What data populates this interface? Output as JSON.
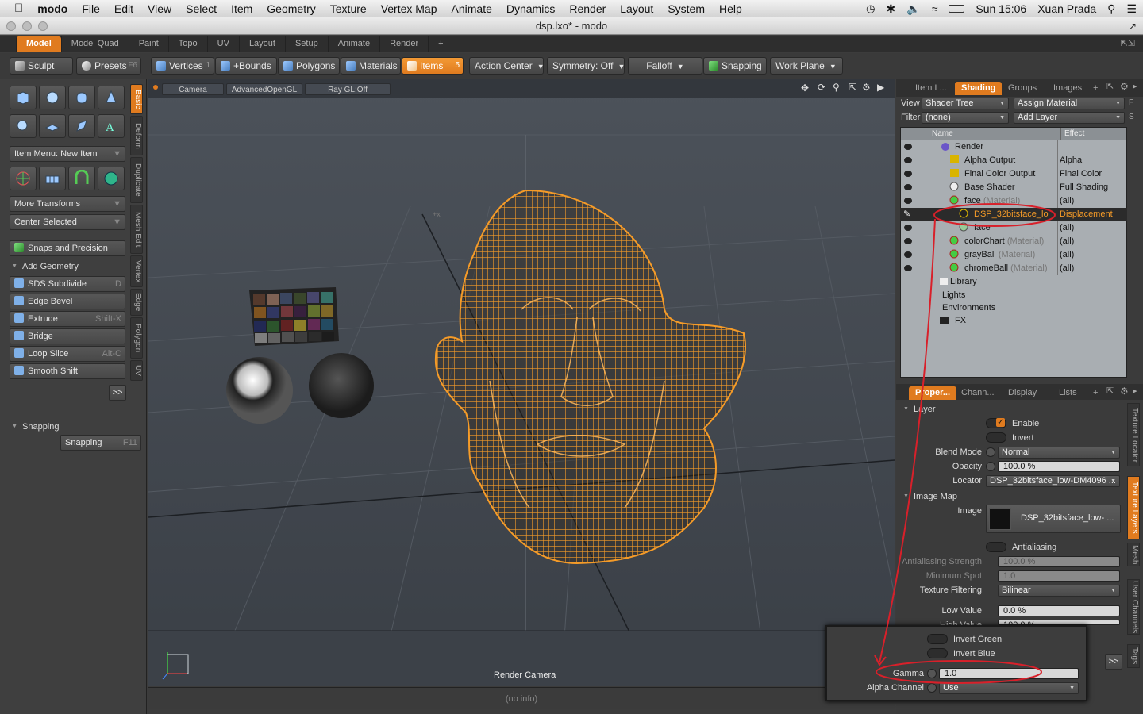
{
  "menubar": {
    "app": "modo",
    "items": [
      "File",
      "Edit",
      "View",
      "Select",
      "Item",
      "Geometry",
      "Texture",
      "Vertex Map",
      "Animate",
      "Dynamics",
      "Render",
      "Layout",
      "System",
      "Help"
    ],
    "clock": "Sun 15:06",
    "user": "Xuan Prada"
  },
  "window": {
    "title": "dsp.lxo* - modo"
  },
  "layout_tabs": [
    "Model",
    "Model Quad",
    "Paint",
    "Topo",
    "UV",
    "Layout",
    "Setup",
    "Animate",
    "Render",
    "+"
  ],
  "toolbar": {
    "sculpt": "Sculpt",
    "presets": "Presets",
    "presets_key": "F6",
    "vertices": "Vertices",
    "vertices_count": "1",
    "bounds": "+Bounds",
    "polygons": "Polygons",
    "materials": "Materials",
    "items": "Items",
    "items_count": "5",
    "action_center": "Action Center",
    "symmetry": "Symmetry: Off",
    "falloff": "Falloff",
    "snapping": "Snapping",
    "work_plane": "Work Plane"
  },
  "left": {
    "item_menu": "Item Menu: New Item",
    "more_transforms": "More Transforms",
    "center_selected": "Center Selected",
    "snaps": "Snaps and Precision",
    "add_geometry": "Add Geometry",
    "tools": [
      {
        "label": "SDS Subdivide",
        "key": "D"
      },
      {
        "label": "Edge Bevel",
        "key": ""
      },
      {
        "label": "Extrude",
        "key": "Shift-X"
      },
      {
        "label": "Bridge",
        "key": ""
      },
      {
        "label": "Loop Slice",
        "key": "Alt-C"
      },
      {
        "label": "Smooth Shift",
        "key": ""
      }
    ],
    "more_button": ">>",
    "snapping_header": "Snapping",
    "snapping_btn": "Snapping",
    "snapping_key": "F11",
    "vtabs": [
      "Basic",
      "Deform",
      "Duplicate",
      "Mesh Edit",
      "Vertex",
      "Edge",
      "Polygon",
      "UV"
    ]
  },
  "viewport": {
    "tabs": [
      "Camera",
      "AdvancedOpenGL",
      "Ray GL:Off"
    ],
    "camera_label": "Render Camera",
    "info": "(no info)",
    "colors": {
      "wire": "#f59b28",
      "bg": "#444a52"
    }
  },
  "shader": {
    "tabs": [
      "Item L...",
      "Shading",
      "Groups",
      "Images",
      "+"
    ],
    "view_label": "View",
    "view_value": "Shader Tree",
    "assign_material": "Assign Material",
    "assign_key": "F",
    "filter_label": "Filter",
    "filter_value": "(none)",
    "add_layer": "Add Layer",
    "add_layer_key": "S",
    "col_name": "Name",
    "col_effect": "Effect",
    "rows": [
      {
        "name": "Render",
        "effect": "",
        "sub": ""
      },
      {
        "name": "Alpha Output",
        "effect": "Alpha",
        "sub": ""
      },
      {
        "name": "Final Color Output",
        "effect": "Final Color",
        "sub": ""
      },
      {
        "name": "Base Shader",
        "effect": "Full Shading",
        "sub": ""
      },
      {
        "name": "face",
        "effect": "(all)",
        "sub": "(Material)"
      },
      {
        "name": "DSP_32bitsface_lo",
        "effect": "Displacement",
        "sub": ""
      },
      {
        "name": "face",
        "effect": "(all)",
        "sub": ""
      },
      {
        "name": "colorChart",
        "effect": "(all)",
        "sub": "(Material)"
      },
      {
        "name": "grayBall",
        "effect": "(all)",
        "sub": "(Material)"
      },
      {
        "name": "chromeBall",
        "effect": "(all)",
        "sub": "(Material)"
      },
      {
        "name": "Library",
        "effect": "",
        "sub": ""
      },
      {
        "name": "Lights",
        "effect": "",
        "sub": ""
      },
      {
        "name": "Environments",
        "effect": "",
        "sub": ""
      },
      {
        "name": "FX",
        "effect": "",
        "sub": ""
      }
    ]
  },
  "properties": {
    "tabs": [
      "Proper...",
      "Chann...",
      "Display",
      "Lists",
      "+"
    ],
    "layer_header": "Layer",
    "enable": "Enable",
    "invert": "Invert",
    "blend_mode_label": "Blend Mode",
    "blend_mode": "Normal",
    "opacity_label": "Opacity",
    "opacity": "100.0 %",
    "locator_label": "Locator",
    "locator": "DSP_32bitsface_low-DM4096 ...",
    "image_map_header": "Image Map",
    "image_label": "Image",
    "image": "DSP_32bitsface_low- ...",
    "antialiasing": "Antialiasing",
    "aa_strength_label": "Antialiasing Strength",
    "aa_strength": "100.0 %",
    "min_spot_label": "Minimum Spot",
    "min_spot": "1.0",
    "tex_filter_label": "Texture Filtering",
    "tex_filter": "Bilinear",
    "low_value_label": "Low Value",
    "low_value": "0.0 %",
    "high_value_label": "High Value",
    "high_value": "100.0 %",
    "more_button": ">>",
    "vtabs": [
      "Texture Locator",
      "Texture Layers",
      "Mesh",
      "User Channels",
      "Tags"
    ]
  },
  "popup": {
    "invert_green": "Invert Green",
    "invert_blue": "Invert Blue",
    "gamma_label": "Gamma",
    "gamma": "1.0",
    "alpha_label": "Alpha Channel",
    "alpha": "Use"
  },
  "accent": "#e07b1f",
  "annotation_color": "#d8202a"
}
